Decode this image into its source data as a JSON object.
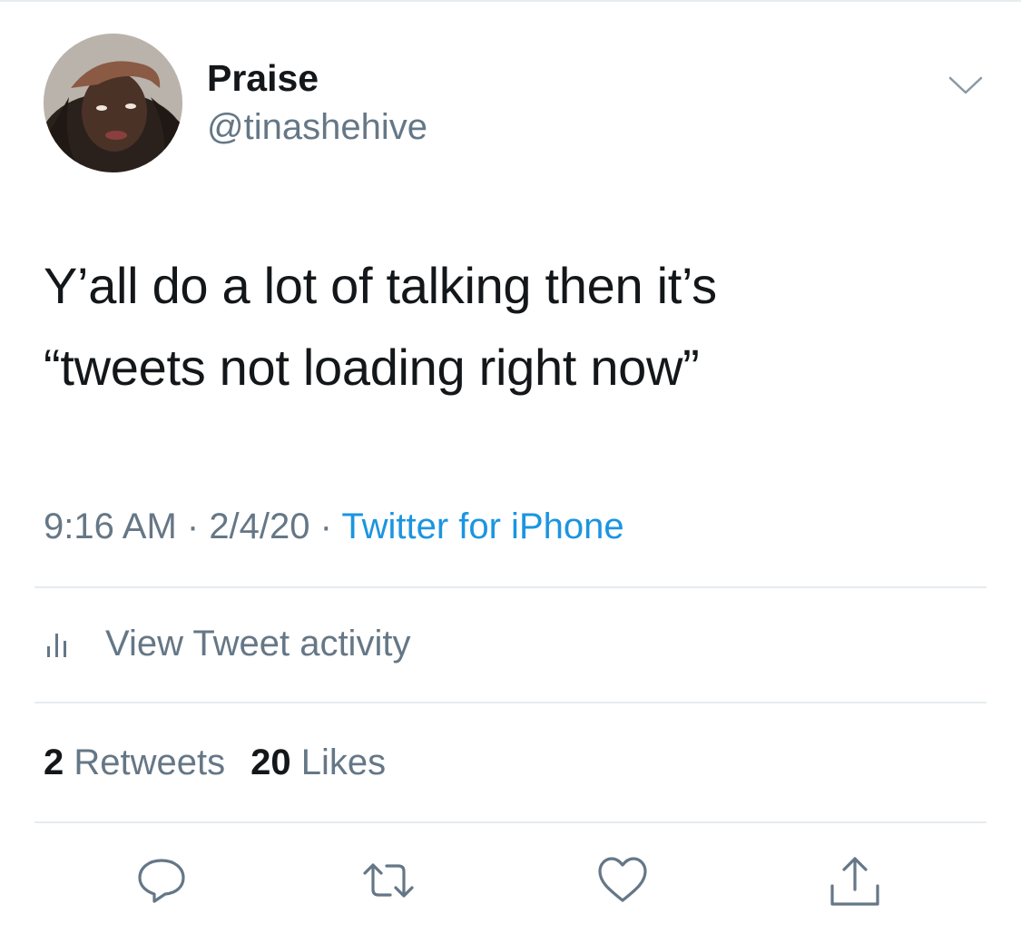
{
  "user": {
    "display_name": "Praise",
    "handle": "@tinashehive"
  },
  "tweet": {
    "text": "Y’all do a lot of talking then it’s\n“tweets not loading right now”",
    "time": "9:16 AM",
    "separator": " · ",
    "date": "2/4/20",
    "source": "Twitter for iPhone"
  },
  "activity": {
    "label": "View Tweet activity"
  },
  "stats": {
    "retweets_count": "2",
    "retweets_label": "Retweets",
    "likes_count": "20",
    "likes_label": "Likes"
  },
  "icons": {
    "menu": "chevron-down-icon",
    "activity": "bar-chart-icon",
    "reply": "reply-icon",
    "retweet": "retweet-icon",
    "like": "heart-icon",
    "share": "share-icon"
  },
  "colors": {
    "text": "#14171a",
    "secondary": "#657786",
    "link": "#1b95e0",
    "divider": "#e6ecf0",
    "icon": "#657786"
  }
}
